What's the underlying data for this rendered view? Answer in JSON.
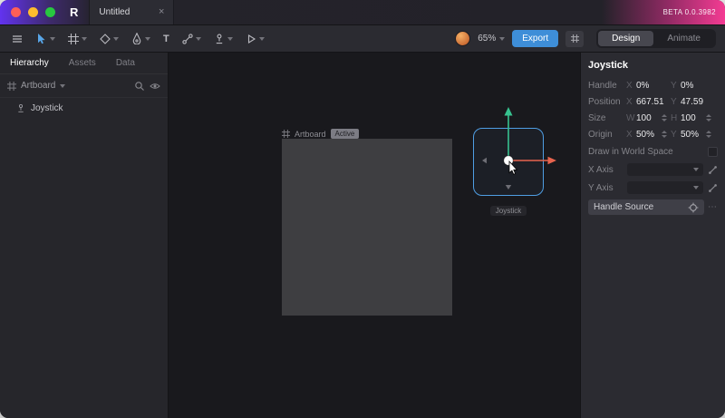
{
  "titlebar": {
    "logo": "R",
    "tab_title": "Untitled",
    "tab_close": "×",
    "beta": "BETA 0.0.3982"
  },
  "toolbar": {
    "text_tool": "T",
    "zoom": "65%",
    "export": "Export",
    "modes": [
      {
        "label": "Design"
      },
      {
        "label": "Animate"
      }
    ]
  },
  "sidebar": {
    "tabs": [
      {
        "label": "Hierarchy"
      },
      {
        "label": "Assets"
      },
      {
        "label": "Data"
      }
    ],
    "artboard_selector": "Artboard",
    "tree_item": "Joystick"
  },
  "canvas": {
    "artboard_name": "Artboard",
    "artboard_status": "Active",
    "joystick_label": "Joystick"
  },
  "inspector": {
    "title": "Joystick",
    "rows": [
      {
        "label": "Handle",
        "k1": "X",
        "v1": "0%",
        "k2": "Y",
        "v2": "0%"
      },
      {
        "label": "Position",
        "k1": "X",
        "v1": "667.51",
        "k2": "Y",
        "v2": "47.59"
      },
      {
        "label": "Size",
        "k1": "W",
        "v1": "100",
        "k2": "H",
        "v2": "100"
      },
      {
        "label": "Origin",
        "k1": "X",
        "v1": "50%",
        "k2": "Y",
        "v2": "50%"
      }
    ],
    "world_space_label": "Draw in World Space",
    "x_axis_label": "X Axis",
    "y_axis_label": "Y Axis",
    "handle_source_label": "Handle Source",
    "more": "⋯"
  },
  "colors": {
    "accent_blue": "#3e8ed8",
    "selection_blue": "#4f9ee3",
    "axis_green": "#37c28f",
    "axis_red": "#e8644e",
    "titlebar_purple": "#6233ef",
    "titlebar_pink": "#f43b93"
  }
}
